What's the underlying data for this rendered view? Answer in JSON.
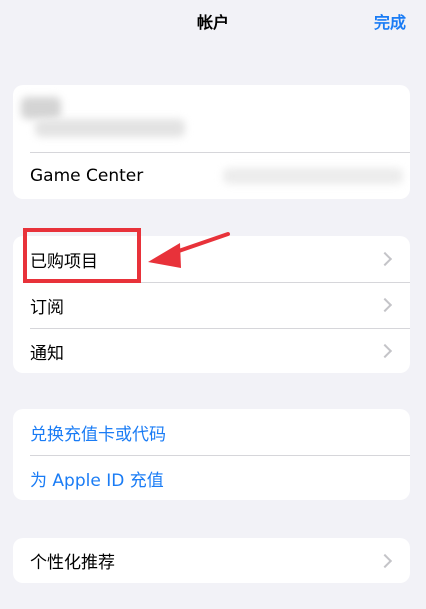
{
  "header": {
    "title": "帐户",
    "done_label": "完成"
  },
  "account_card": {
    "game_center_label": "Game Center"
  },
  "purchases_card": {
    "items": [
      {
        "label": "已购项目"
      },
      {
        "label": "订阅"
      },
      {
        "label": "通知"
      }
    ]
  },
  "redeem_card": {
    "items": [
      {
        "label": "兑换充值卡或代码"
      },
      {
        "label": "为 Apple ID 充值"
      }
    ]
  },
  "personal_card": {
    "label": "个性化推荐"
  },
  "colors": {
    "accent": "#1a7cf5",
    "annotation": "#e8323a",
    "background": "#f2f2f7"
  }
}
